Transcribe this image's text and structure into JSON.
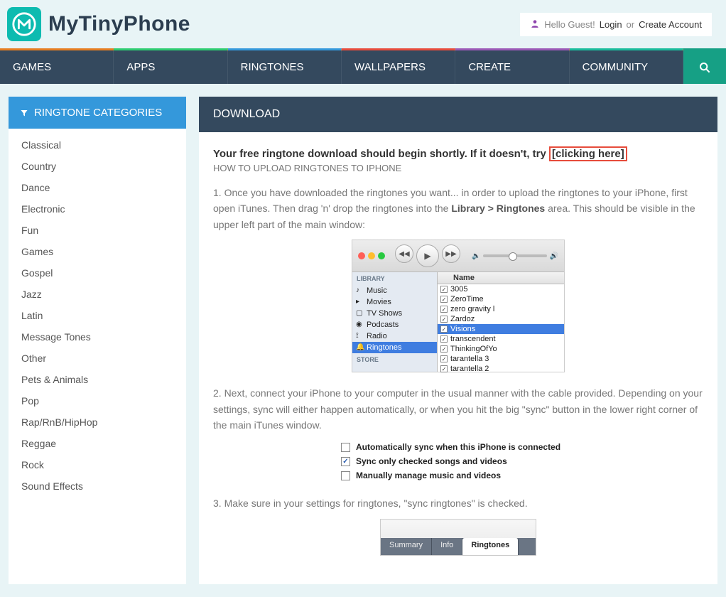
{
  "site": {
    "title": "MyTinyPhone"
  },
  "user": {
    "greeting": "Hello Guest!",
    "login": "Login",
    "or": "or",
    "create": "Create Account"
  },
  "nav": {
    "games": "GAMES",
    "apps": "APPS",
    "ringtones": "RINGTONES",
    "wallpapers": "WALLPAPERS",
    "create": "CREATE",
    "community": "COMMUNITY"
  },
  "sidebar": {
    "header": "RINGTONE CATEGORIES",
    "items": [
      "Classical",
      "Country",
      "Dance",
      "Electronic",
      "Fun",
      "Games",
      "Gospel",
      "Jazz",
      "Latin",
      "Message Tones",
      "Other",
      "Pets & Animals",
      "Pop",
      "Rap/RnB/HipHop",
      "Reggae",
      "Rock",
      "Sound Effects"
    ]
  },
  "content": {
    "header": "DOWNLOAD",
    "alert_prefix": "Your free ringtone download should begin shortly. If it doesn't, try ",
    "alert_link": "[clicking here]",
    "subhead": "HOW TO UPLOAD RINGTONES TO IPHONE",
    "step1_a": "1. Once you have downloaded the ringtones you want... in order to upload the ringtones to your iPhone, first open iTunes. Then drag 'n' drop the ringtones into the ",
    "step1_b": "Library > Ringtones",
    "step1_c": " area. This should be visible in the upper left part of the main window:",
    "step2": "2. Next, connect your iPhone to your computer in the usual manner with the cable provided. Depending on your settings, sync will either happen automatically, or when you hit the big \"sync\" button in the lower right corner of the main iTunes window.",
    "step3": "3. Make sure in your settings for ringtones, \"sync ringtones\" is checked."
  },
  "itunes": {
    "library": "LIBRARY",
    "store": "STORE",
    "side_items": [
      {
        "icon": "♪",
        "label": "Music"
      },
      {
        "icon": "▸",
        "label": "Movies"
      },
      {
        "icon": "▢",
        "label": "TV Shows"
      },
      {
        "icon": "◉",
        "label": "Podcasts"
      },
      {
        "icon": "⟟",
        "label": "Radio"
      },
      {
        "icon": "🔔",
        "label": "Ringtones"
      }
    ],
    "name_col": "Name",
    "rows": [
      "3005",
      "ZeroTime",
      "zero gravity l",
      "Zardoz",
      "Visions",
      "transcendent",
      "ThinkingOfYo",
      "tarantella 3",
      "tarantella 2"
    ]
  },
  "sync": {
    "opt1": "Automatically sync when this iPhone is connected",
    "opt2": "Sync only checked songs and videos",
    "opt3": "Manually manage music and videos"
  },
  "tabs": {
    "summary": "Summary",
    "info": "Info",
    "ringtones": "Ringtones"
  }
}
